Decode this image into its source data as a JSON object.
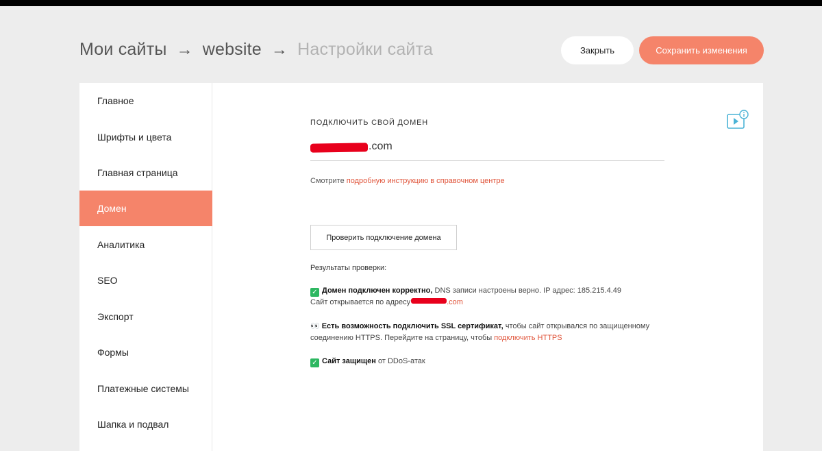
{
  "header": {
    "breadcrumb": {
      "item1": "Мои сайты",
      "item2": "website",
      "current": "Настройки сайта",
      "separator": "→"
    },
    "close_label": "Закрыть",
    "save_label": "Сохранить изменения"
  },
  "sidebar": {
    "items": [
      {
        "label": "Главное"
      },
      {
        "label": "Шрифты и цвета"
      },
      {
        "label": "Главная страница"
      },
      {
        "label": "Домен"
      },
      {
        "label": "Аналитика"
      },
      {
        "label": "SEO"
      },
      {
        "label": "Экспорт"
      },
      {
        "label": "Формы"
      },
      {
        "label": "Платежные системы"
      },
      {
        "label": "Шапка и подвал"
      }
    ],
    "active": "Домен"
  },
  "domain": {
    "section_label": "ПОДКЛЮЧИТЬ СВОЙ ДОМЕН",
    "value_suffix": ".com",
    "hint_prefix": "Смотрите",
    "hint_link": "подробную инструкцию в справочном центре",
    "check_button": "Проверить подключение домена",
    "results_label": "Результаты проверки:",
    "result1": {
      "bold": "Домен подключен корректно,",
      "text": "DNS записи настроены верно. IP адрес: 185.215.4.49",
      "line2_prefix": "Сайт открывается по адресу",
      "line2_suffix": ".com"
    },
    "result2": {
      "bold": "Есть возможность подключить SSL сертификат,",
      "text": "чтобы сайт открывался по защищенному соединению HTTPS. Перейдите на страницу, чтобы",
      "link": "подключить HTTPS"
    },
    "result3": {
      "bold": "Сайт защищен",
      "text": "от DDoS-атак"
    }
  },
  "icons": {
    "help": "video-help-icon",
    "check": "checkmark-icon",
    "eyes": "eyes-icon"
  },
  "colors": {
    "accent": "#f5846a",
    "link": "#e0543a",
    "success": "#2db761",
    "help_icon": "#4ab3d6",
    "redaction": "#e8001c"
  }
}
